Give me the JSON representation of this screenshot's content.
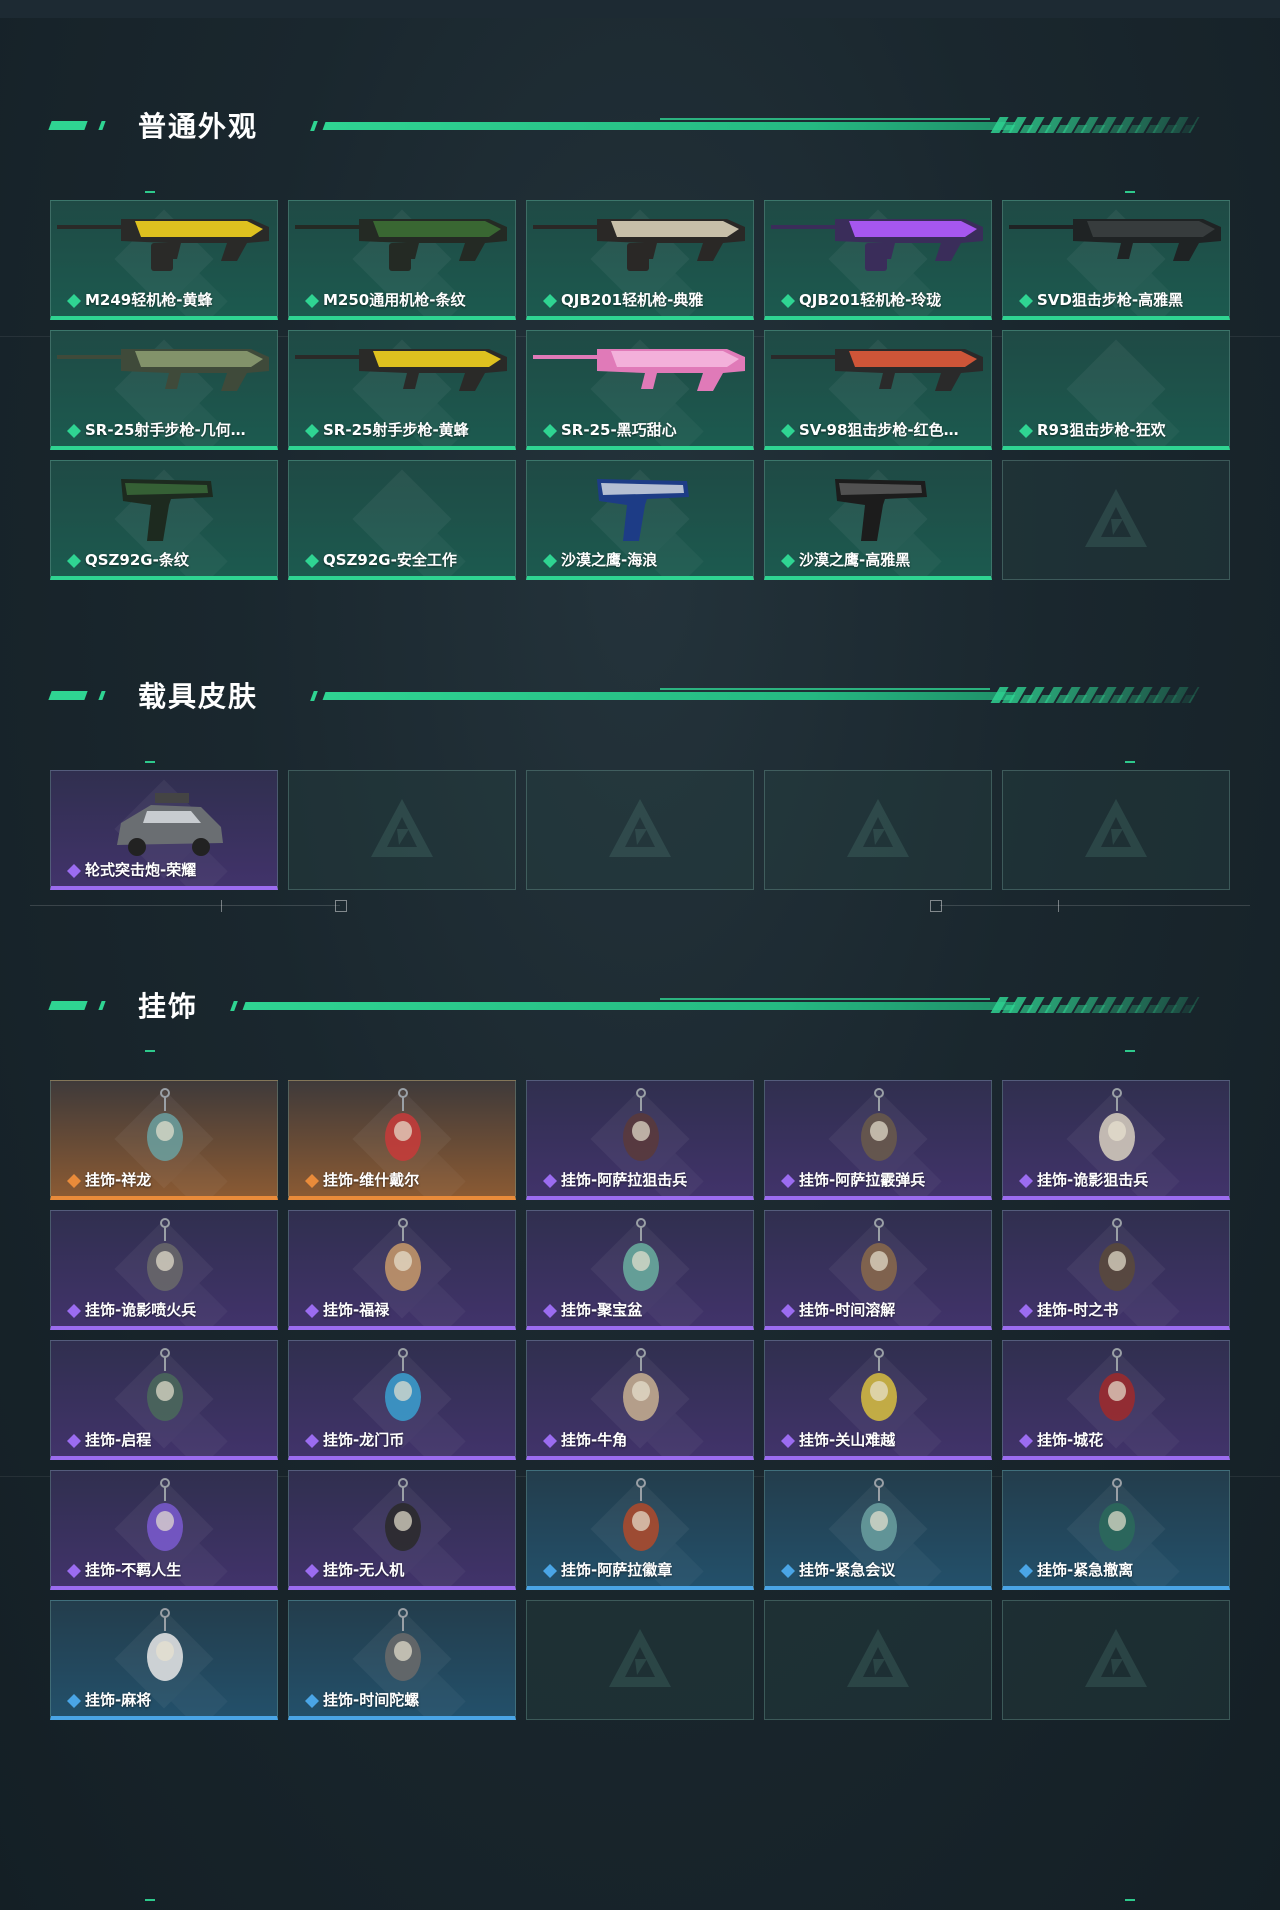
{
  "sections": [
    {
      "title": "普通外观",
      "cards": [
        {
          "label": "M249轻机枪-黄蜂",
          "rarity": "green",
          "icon": "machinegun-yellow"
        },
        {
          "label": "M250通用机枪-条纹",
          "rarity": "green",
          "icon": "machinegun-green"
        },
        {
          "label": "QJB201轻机枪-典雅",
          "rarity": "green",
          "icon": "machinegun-beige"
        },
        {
          "label": "QJB201轻机枪-玲珑",
          "rarity": "green",
          "icon": "machinegun-purple"
        },
        {
          "label": "SVD狙击步枪-高雅黑",
          "rarity": "green",
          "icon": "sniper-black"
        },
        {
          "label": "SR-25射手步枪-几何…",
          "rarity": "green",
          "icon": "rifle-camo"
        },
        {
          "label": "SR-25射手步枪-黄蜂",
          "rarity": "green",
          "icon": "rifle-yellow"
        },
        {
          "label": "SR-25-黑巧甜心",
          "rarity": "green",
          "icon": "rifle-pink"
        },
        {
          "label": "SV-98狙击步枪-红色…",
          "rarity": "green",
          "icon": "sniper-red"
        },
        {
          "label": "R93狙击步枪-狂欢",
          "rarity": "green",
          "icon": ""
        },
        {
          "label": "QSZ92G-条纹",
          "rarity": "green",
          "icon": "pistol-green"
        },
        {
          "label": "QSZ92G-安全工作",
          "rarity": "green",
          "icon": ""
        },
        {
          "label": "沙漠之鹰-海浪",
          "rarity": "green",
          "icon": "pistol-blue"
        },
        {
          "label": "沙漠之鹰-高雅黑",
          "rarity": "green",
          "icon": "pistol-black"
        },
        {
          "label": "",
          "rarity": "empty",
          "icon": ""
        }
      ]
    },
    {
      "title": "载具皮肤",
      "cards": [
        {
          "label": "轮式突击炮-荣耀",
          "rarity": "purple",
          "icon": "vehicle"
        },
        {
          "label": "",
          "rarity": "empty",
          "icon": ""
        },
        {
          "label": "",
          "rarity": "empty",
          "icon": ""
        },
        {
          "label": "",
          "rarity": "empty",
          "icon": ""
        },
        {
          "label": "",
          "rarity": "empty",
          "icon": ""
        }
      ]
    },
    {
      "title": "挂饰",
      "cards": [
        {
          "label": "挂饰-祥龙",
          "rarity": "orange",
          "icon": "charm"
        },
        {
          "label": "挂饰-维什戴尔",
          "rarity": "orange",
          "icon": "charm"
        },
        {
          "label": "挂饰-阿萨拉狙击兵",
          "rarity": "purple",
          "icon": "charm"
        },
        {
          "label": "挂饰-阿萨拉霰弹兵",
          "rarity": "purple",
          "icon": "charm"
        },
        {
          "label": "挂饰-诡影狙击兵",
          "rarity": "purple",
          "icon": "charm"
        },
        {
          "label": "挂饰-诡影喷火兵",
          "rarity": "purple",
          "icon": "charm"
        },
        {
          "label": "挂饰-福禄",
          "rarity": "purple",
          "icon": "charm"
        },
        {
          "label": "挂饰-聚宝盆",
          "rarity": "purple",
          "icon": "charm"
        },
        {
          "label": "挂饰-时间溶解",
          "rarity": "purple",
          "icon": "charm"
        },
        {
          "label": "挂饰-时之书",
          "rarity": "purple",
          "icon": "charm"
        },
        {
          "label": "挂饰-启程",
          "rarity": "purple",
          "icon": "charm"
        },
        {
          "label": "挂饰-龙门币",
          "rarity": "purple",
          "icon": "charm"
        },
        {
          "label": "挂饰-牛角",
          "rarity": "purple",
          "icon": "charm"
        },
        {
          "label": "挂饰-关山难越",
          "rarity": "purple",
          "icon": "charm"
        },
        {
          "label": "挂饰-城花",
          "rarity": "purple",
          "icon": "charm"
        },
        {
          "label": "挂饰-不羁人生",
          "rarity": "purple",
          "icon": "charm"
        },
        {
          "label": "挂饰-无人机",
          "rarity": "purple",
          "icon": "charm"
        },
        {
          "label": "挂饰-阿萨拉徽章",
          "rarity": "blue",
          "icon": "charm"
        },
        {
          "label": "挂饰-紧急会议",
          "rarity": "blue",
          "icon": "charm"
        },
        {
          "label": "挂饰-紧急撤离",
          "rarity": "blue",
          "icon": "charm"
        },
        {
          "label": "挂饰-麻将",
          "rarity": "blue",
          "icon": "charm"
        },
        {
          "label": "挂饰-时间陀螺",
          "rarity": "blue",
          "icon": "charm"
        },
        {
          "label": "",
          "rarity": "empty",
          "icon": ""
        },
        {
          "label": "",
          "rarity": "empty",
          "icon": ""
        },
        {
          "label": "",
          "rarity": "empty",
          "icon": ""
        }
      ]
    }
  ],
  "colors": {
    "accent": "#2fd492",
    "green": "#2fd492",
    "purple": "#9b6cf0",
    "orange": "#e98b3a",
    "blue": "#4aa5e6"
  }
}
